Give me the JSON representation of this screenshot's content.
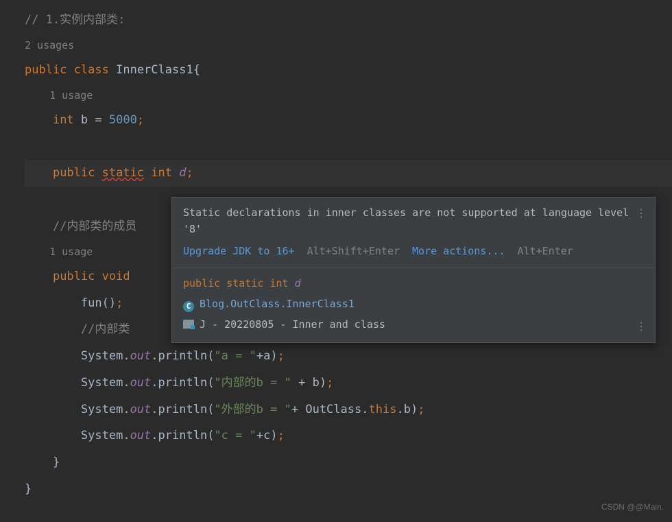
{
  "code": {
    "l1_comment": "// 1.实例内部类:",
    "l2_usage": "2 usages",
    "l3_a": "public",
    "l3_b": "class",
    "l3_c": "InnerClass1{",
    "l4_usage": "1 usage",
    "l5_a": "int",
    "l5_b": "b",
    "l5_eq": "=",
    "l5_c": "5000",
    "l5_sc": ";",
    "l6_a": "public",
    "l6_b": "static",
    "l6_c": "int",
    "l6_d": "d",
    "l6_sc": ";",
    "l7_comment": "//内部类的成员",
    "l8_usage": "1 usage",
    "l9_a": "public",
    "l9_b": "void",
    "l10_a": "fun()",
    "l10_sc": ";",
    "l11_comment": "//内部类",
    "sys": "System",
    "dot": ".",
    "out": "out",
    "println": "println",
    "lp": "(",
    "rp": ")",
    "l12_str": "\"a = \"",
    "l12_plus": "+",
    "l12_var": "a",
    "l13_str": "\"内部的b = \"",
    "l13_plus": " + ",
    "l13_var": "b",
    "l14_str": "\"外部的b = \"",
    "l14_plus": "+ ",
    "l14_cls": "OutClass",
    "l14_this": "this",
    "l14_b": "b",
    "l15_str": "\"c = \"",
    "l15_plus": "+",
    "l15_var": "c",
    "rbrace1": "}",
    "rbrace2": "}"
  },
  "tooltip": {
    "title": "Static declarations in inner classes are not supported at language level '8'",
    "action1": "Upgrade JDK to 16+",
    "shortcut1": "Alt+Shift+Enter",
    "action2": "More actions...",
    "shortcut2": "Alt+Enter",
    "sig_kw1": "public",
    "sig_kw2": "static",
    "sig_ty": "int",
    "sig_name": "d",
    "class_icon": "C",
    "qname": "Blog.OutClass.InnerClass1",
    "folder": "J - 20220805 - Inner and class"
  },
  "watermark": "CSDN @@Main."
}
